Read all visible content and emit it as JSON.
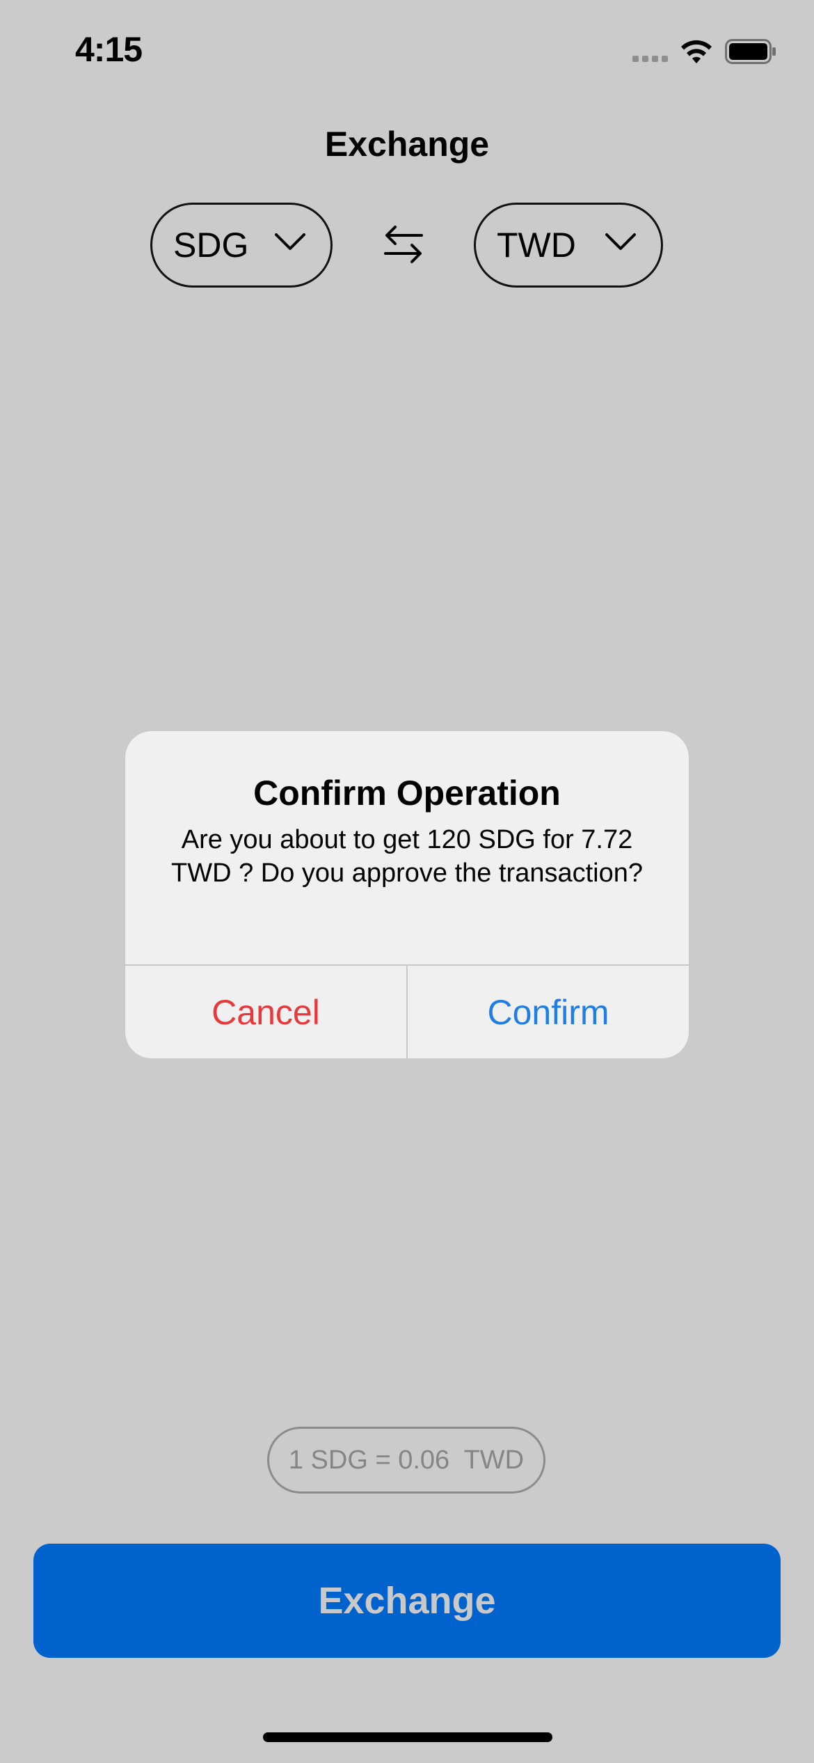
{
  "status_bar": {
    "time": "4:15",
    "icons": [
      "cellular-signal-icon",
      "wifi-icon",
      "battery-icon"
    ]
  },
  "header": {
    "title": "Exchange"
  },
  "currency_selector": {
    "from": "SDG",
    "to": "TWD",
    "swap_icon": "swap-arrows-icon",
    "dropdown_icon": "chevron-down-icon"
  },
  "dialog": {
    "title": "Confirm Operation",
    "message": "Are you about to get 120 SDG for 7.72 TWD ? Do you approve the transaction?",
    "cancel_label": "Cancel",
    "confirm_label": "Confirm"
  },
  "rate": {
    "text": "1 SDG = 0.06  TWD"
  },
  "actions": {
    "exchange_label": "Exchange"
  },
  "colors": {
    "background_dim": "#cbcbcb",
    "primary_button": "#0062cc",
    "cancel": "#e8383a",
    "confirm": "#1f7ee6"
  }
}
